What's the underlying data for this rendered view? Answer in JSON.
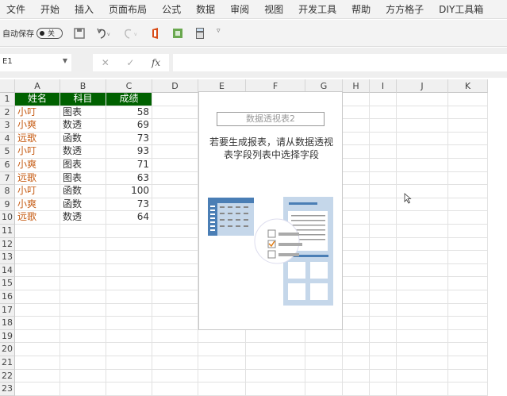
{
  "menu": [
    "文件",
    "开始",
    "插入",
    "页面布局",
    "公式",
    "数据",
    "审阅",
    "视图",
    "开发工具",
    "帮助",
    "方方格子",
    "DIY工具箱"
  ],
  "qat": {
    "autosave_label": "自动保存",
    "toggle_state": "关",
    "icons": [
      "save-icon",
      "undo-icon",
      "redo-icon",
      "office-icon",
      "addin-icon",
      "calculator-icon",
      "customize-icon"
    ]
  },
  "formula_bar": {
    "name_box": "E1",
    "fx": "fx",
    "value": ""
  },
  "columns": [
    "A",
    "B",
    "C",
    "D",
    "E",
    "F",
    "G",
    "H",
    "I",
    "J",
    "K"
  ],
  "rows": [
    "1",
    "2",
    "3",
    "4",
    "5",
    "6",
    "7",
    "8",
    "9",
    "10",
    "11",
    "12",
    "13",
    "14",
    "15",
    "16",
    "17",
    "18",
    "19",
    "20",
    "21",
    "22",
    "23"
  ],
  "table": {
    "headers": [
      "姓名",
      "科目",
      "成绩"
    ],
    "data": [
      [
        "小叮",
        "图表",
        "58"
      ],
      [
        "小爽",
        "数透",
        "69"
      ],
      [
        "远歌",
        "函数",
        "73"
      ],
      [
        "小叮",
        "数透",
        "93"
      ],
      [
        "小爽",
        "图表",
        "71"
      ],
      [
        "远歌",
        "图表",
        "63"
      ],
      [
        "小叮",
        "函数",
        "100"
      ],
      [
        "小爽",
        "函数",
        "73"
      ],
      [
        "远歌",
        "数透",
        "64"
      ]
    ]
  },
  "pivot": {
    "title": "数据透视表2",
    "line1": "若要生成报表，请从数据透视",
    "line2": "表字段列表中选择字段"
  },
  "colors": {
    "header_fill": "#006100",
    "name_text": "#c55a11",
    "illustration_blue": "#4a7eb5",
    "illustration_light": "#c5d7ea"
  }
}
